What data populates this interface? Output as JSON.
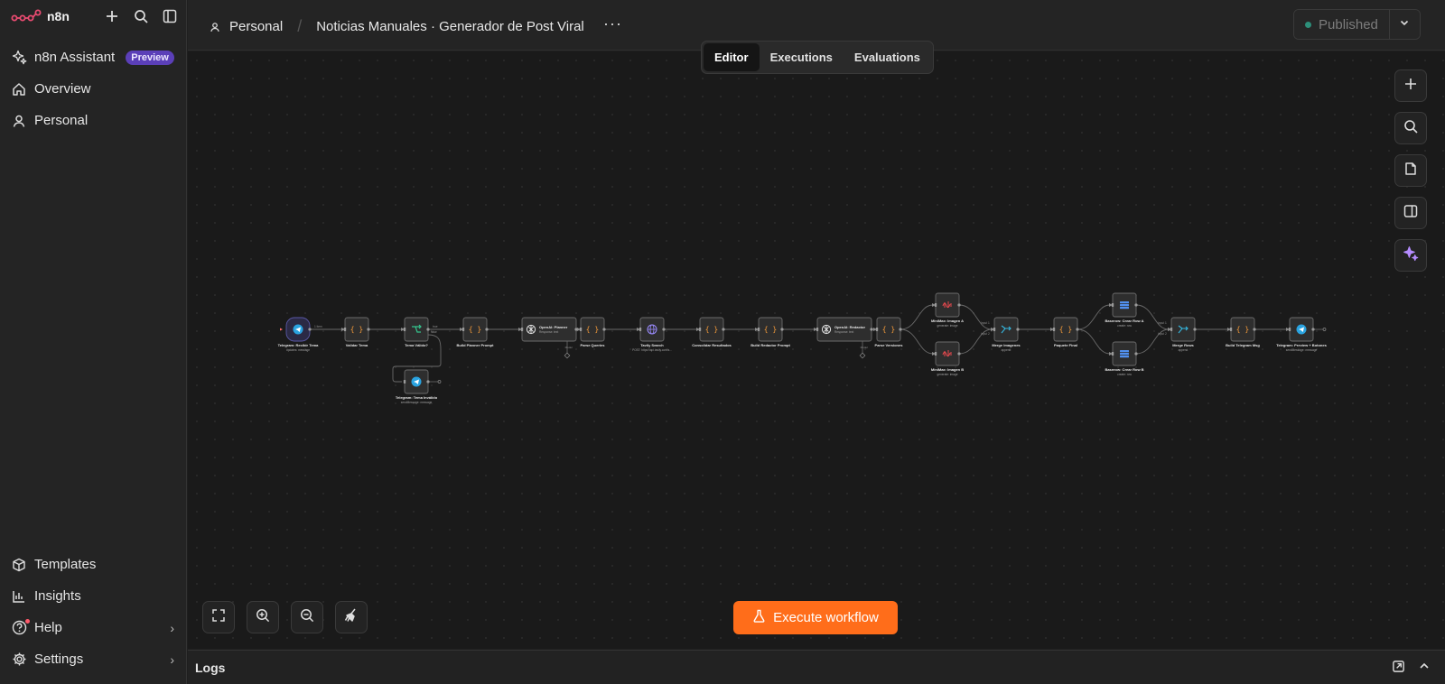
{
  "app": {
    "name": "n8n"
  },
  "sidebar": {
    "top_items": [
      {
        "label": "n8n Assistant",
        "badge": "Preview"
      },
      {
        "label": "Overview"
      },
      {
        "label": "Personal"
      }
    ],
    "bottom_items": [
      {
        "label": "Templates"
      },
      {
        "label": "Insights"
      },
      {
        "label": "Help"
      },
      {
        "label": "Settings"
      }
    ]
  },
  "header": {
    "project": "Personal",
    "workflow_name": "Noticias Manuales · Generador de Post Viral",
    "more": "···",
    "publish_label": "Published"
  },
  "tabs": [
    {
      "label": "Editor",
      "active": true
    },
    {
      "label": "Executions",
      "active": false
    },
    {
      "label": "Evaluations",
      "active": false
    }
  ],
  "execute_label": "Execute workflow",
  "logs_label": "Logs",
  "colors": {
    "accent": "#ff6d1a",
    "brand": "#ea4b71",
    "published_dot": "#2d8f7a"
  },
  "workflow": {
    "nodes": [
      {
        "id": "n1",
        "title": "Telegram: Recibir Tema",
        "sub": "updates: message",
        "icon": "telegram-icon",
        "trigger": true
      },
      {
        "id": "n2",
        "title": "Validar Tema",
        "sub": "",
        "icon": "code-icon"
      },
      {
        "id": "n3",
        "title": "Tema Válido?",
        "sub": "",
        "icon": "if-icon"
      },
      {
        "id": "n4",
        "title": "Build Planner Prompt",
        "sub": "",
        "icon": "code-icon"
      },
      {
        "id": "n5",
        "title": "OpenAI: Planner",
        "sub": "Response: text",
        "icon": "openai-icon",
        "wide": true
      },
      {
        "id": "n6",
        "title": "Parse Queries",
        "sub": "",
        "icon": "code-icon"
      },
      {
        "id": "n7",
        "title": "Tavily Search",
        "sub": "POST: https://api.tavily.com/s...",
        "icon": "globe-icon"
      },
      {
        "id": "n8",
        "title": "Consolidar Resultados",
        "sub": "",
        "icon": "code-icon"
      },
      {
        "id": "n9",
        "title": "Build Redactor Prompt",
        "sub": "",
        "icon": "code-icon"
      },
      {
        "id": "n10",
        "title": "OpenAI: Redactor",
        "sub": "Response: text",
        "icon": "openai-icon",
        "wide": true
      },
      {
        "id": "n11",
        "title": "Parse Versiones",
        "sub": "",
        "icon": "code-icon"
      },
      {
        "id": "n12",
        "title": "MiniMax: Imagen A",
        "sub": "generate: image",
        "icon": "minimax-icon"
      },
      {
        "id": "n13",
        "title": "MiniMax: Imagen B",
        "sub": "generate: image",
        "icon": "minimax-icon"
      },
      {
        "id": "n14",
        "title": "Merge Imagenes",
        "sub": "append",
        "icon": "merge-icon"
      },
      {
        "id": "n15",
        "title": "Paquete Final",
        "sub": "",
        "icon": "code-icon"
      },
      {
        "id": "n16",
        "title": "Baserow: Crear Row A",
        "sub": "create: row",
        "icon": "baserow-icon"
      },
      {
        "id": "n17",
        "title": "Baserow: Crear Row B",
        "sub": "create: row",
        "icon": "baserow-icon"
      },
      {
        "id": "n18",
        "title": "Merge Rows",
        "sub": "append",
        "icon": "merge-icon"
      },
      {
        "id": "n19",
        "title": "Build Telegram Msg",
        "sub": "",
        "icon": "code-icon"
      },
      {
        "id": "n20",
        "title": "Telegram: Preview + Botones",
        "sub": "sendMessage: message",
        "icon": "telegram-icon"
      },
      {
        "id": "n21",
        "title": "Telegram: Tema Inválido",
        "sub": "sendMessage: message",
        "icon": "telegram-icon"
      }
    ],
    "edge_labels": {
      "item": "1 item",
      "true": "true",
      "false": "false",
      "model": "Model",
      "input1": "Input 1",
      "input2": "Input 2"
    }
  }
}
